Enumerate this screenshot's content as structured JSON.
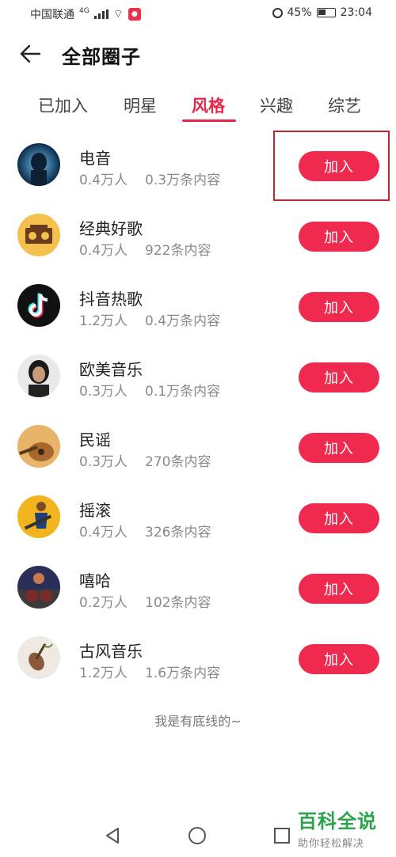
{
  "status_bar": {
    "carrier": "中国联通",
    "network": "4G",
    "battery": "45%",
    "time": "23:04"
  },
  "header": {
    "title": "全部圈子"
  },
  "tabs": [
    {
      "label": "已加入"
    },
    {
      "label": "明星"
    },
    {
      "label": "风格"
    },
    {
      "label": "兴趣"
    },
    {
      "label": "综艺"
    }
  ],
  "active_tab": "风格",
  "circles": [
    {
      "name": "电音",
      "members": "0.4万人",
      "posts": "0.3万条内容",
      "button": "加入"
    },
    {
      "name": "经典好歌",
      "members": "0.4万人",
      "posts": "922条内容",
      "button": "加入"
    },
    {
      "name": "抖音热歌",
      "members": "1.2万人",
      "posts": "0.4万条内容",
      "button": "加入"
    },
    {
      "name": "欧美音乐",
      "members": "0.3万人",
      "posts": "0.1万条内容",
      "button": "加入"
    },
    {
      "name": "民谣",
      "members": "0.3万人",
      "posts": "270条内容",
      "button": "加入"
    },
    {
      "name": "摇滚",
      "members": "0.4万人",
      "posts": "326条内容",
      "button": "加入"
    },
    {
      "name": "嘻哈",
      "members": "0.2万人",
      "posts": "102条内容",
      "button": "加入"
    },
    {
      "name": "古风音乐",
      "members": "1.2万人",
      "posts": "1.6万条内容",
      "button": "加入"
    }
  ],
  "footer_text": "我是有底线的~",
  "watermark": {
    "title": "百科全说",
    "subtitle": "助你轻松解决"
  },
  "colors": {
    "accent": "#f0294f",
    "highlight_box": "#c0262e"
  }
}
